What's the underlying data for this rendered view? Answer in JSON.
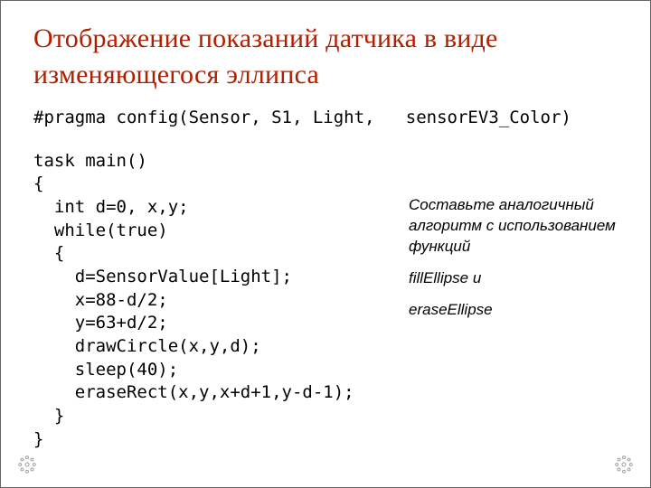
{
  "title": "Отображение показаний датчика в виде изменяющегося эллипса",
  "pragma": "#pragma config(Sensor, S1, Light,   sensorEV3_Color)",
  "code": "task main()\n{\n  int d=0, x,y;\n  while(true)\n  {\n    d=SensorValue[Light];\n    x=88-d/2;\n    y=63+d/2;\n    drawCircle(x,y,d);\n    sleep(40);\n    eraseRect(x,y,x+d+1,y-d-1);\n  }\n}",
  "side": {
    "p1": "Составьте аналогичный алгоритм с использованием функций",
    "p2": "fillEllipse и",
    "p3": "eraseEllipse"
  }
}
